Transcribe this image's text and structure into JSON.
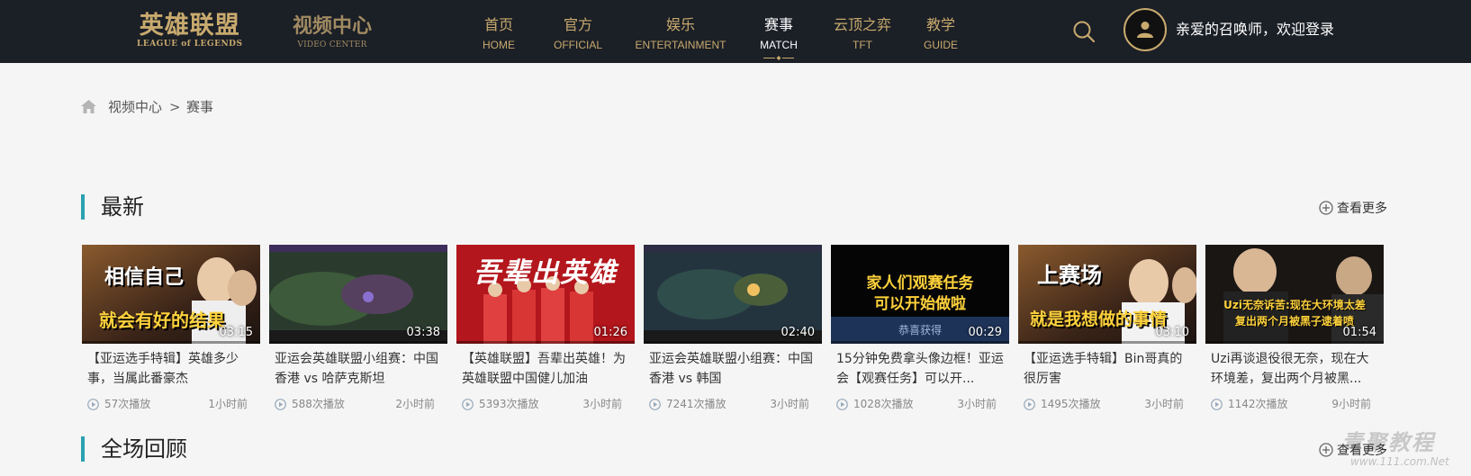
{
  "header": {
    "logo": {
      "cn": "英雄联盟",
      "en": "LEAGUE of LEGENDS"
    },
    "video_center": {
      "cn": "视频中心",
      "en": "VIDEO CENTER"
    },
    "nav": [
      {
        "cn": "首页",
        "en": "HOME",
        "active": false
      },
      {
        "cn": "官方",
        "en": "OFFICIAL",
        "active": false
      },
      {
        "cn": "娱乐",
        "en": "ENTERTAINMENT",
        "active": false
      },
      {
        "cn": "赛事",
        "en": "MATCH",
        "active": true
      },
      {
        "cn": "云顶之弈",
        "en": "TFT",
        "active": false
      },
      {
        "cn": "教学",
        "en": "GUIDE",
        "active": false
      }
    ],
    "search_icon": "search-icon",
    "avatar_icon": "user-icon",
    "login_text": "亲爱的召唤师，欢迎登录"
  },
  "breadcrumb": {
    "home_icon": "home-icon",
    "items": [
      "视频中心",
      "赛事"
    ],
    "separator": ">"
  },
  "sections": [
    {
      "title": "最新",
      "more": "查看更多"
    },
    {
      "title": "全场回顾",
      "more": "查看更多"
    }
  ],
  "videos": [
    {
      "thumb_text": [
        "相信自己",
        "就会有好的结果"
      ],
      "duration": "03:15",
      "title": "【亚运选手特辑】英雄多少事，当属此番豪杰",
      "plays": "57次播放",
      "time": "1小时前"
    },
    {
      "thumb_text": [
        "",
        ""
      ],
      "duration": "03:38",
      "title": "亚运会英雄联盟小组赛：中国香港 vs 哈萨克斯坦",
      "plays": "588次播放",
      "time": "2小时前"
    },
    {
      "thumb_text": [
        "吾辈出英雄",
        ""
      ],
      "duration": "01:26",
      "title": "【英雄联盟】吾辈出英雄！为英雄联盟中国健儿加油",
      "plays": "5393次播放",
      "time": "3小时前"
    },
    {
      "thumb_text": [
        "",
        ""
      ],
      "duration": "02:40",
      "title": "亚运会英雄联盟小组赛：中国香港 vs 韩国",
      "plays": "7241次播放",
      "time": "3小时前"
    },
    {
      "thumb_text": [
        "家人们观赛任务",
        "可以开始做啦",
        "恭喜获得"
      ],
      "duration": "00:29",
      "title": "15分钟免费拿头像边框！亚运会【观赛任务】可以开...",
      "plays": "1028次播放",
      "time": "3小时前"
    },
    {
      "thumb_text": [
        "上赛场",
        "就是我想做的事情"
      ],
      "duration": "03:10",
      "title": "【亚运选手特辑】Bin哥真的很厉害",
      "plays": "1495次播放",
      "time": "3小时前"
    },
    {
      "thumb_text": [
        "Uzi无奈诉苦:现在大环境太差",
        "复出两个月被黑子逮着喷"
      ],
      "duration": "01:54",
      "title": "Uzi再谈退役很无奈，现在大环境差，复出两个月被黑...",
      "plays": "1142次播放",
      "time": "9小时前"
    }
  ],
  "watermark": {
    "line1": "青聚教程",
    "line2": "www.111.com.Net"
  },
  "colors": {
    "header_bg": "#1b1f26",
    "gold": "#c8aa6e",
    "accent_bar": "#2aa1b0",
    "page_bg": "#f5f5f5"
  }
}
